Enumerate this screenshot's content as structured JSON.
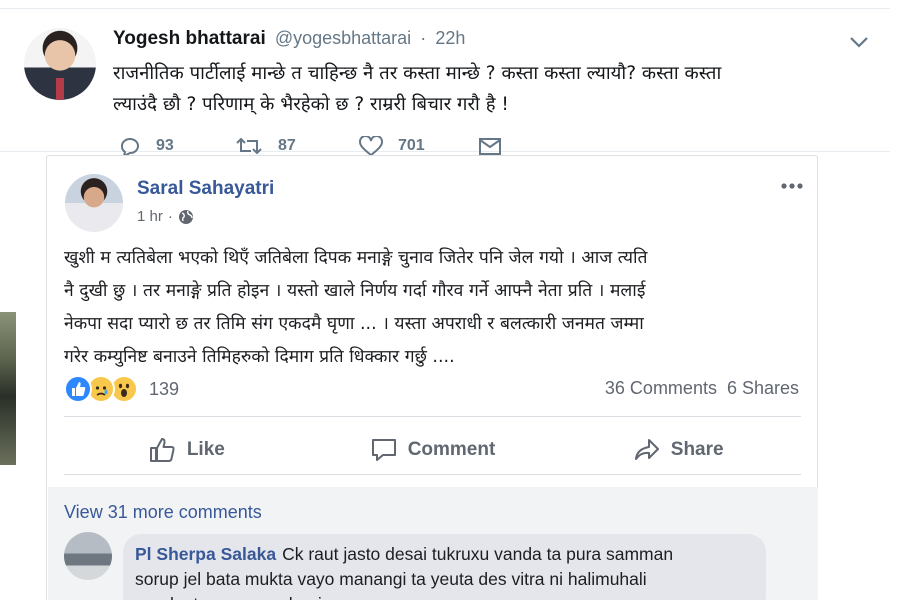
{
  "tweet": {
    "author_name": "Yogesh bhattarai",
    "handle": "@yogesbhattarai",
    "separator": "·",
    "time": "22h",
    "text_line1": "राजनीतिक पार्टीलाई मान्छे त चाहिन्छ नै तर कस्ता मान्छे ? कस्ता कस्ता ल्यायौ? कस्ता कस्ता",
    "text_line2": "ल्याउंदै छौ ? परिणाम्  के भैरहेको छ ? राम्ररी बिचार गरौ है !",
    "reply_count": "93",
    "retweet_count": "87",
    "like_count": "701",
    "icons": [
      "reply-icon",
      "retweet-icon",
      "like-icon",
      "direct-message-icon",
      "chevron-down-icon"
    ]
  },
  "post": {
    "author_name": "Saral Sahayatri",
    "time": "1 hr",
    "separator": "·",
    "audience_icon": "globe-icon",
    "body_line1": "खुशी म त्यतिबेला भएको थिएँ जतिबेला दिपक मनाङ्गे चुनाव जितेर पनि जेल गयो । आज त्यति",
    "body_line2": "नै दुखी छु । तर मनाङ्गे प्रति होइन । यस्तो खाले निर्णय गर्दा गौरव गर्ने आफ्नै नेता प्रति । मलाई",
    "body_line3": "नेकपा सदा प्यारो छ तर तिमि संग एकदमै घृणा ... । यस्ता अपराधी र बलत्कारी जनमत जम्मा",
    "body_line4": "गरेर कम्युनिष्ट बनाउने तिमिहरुको दिमाग प्रति धिक्कार गर्छु ....",
    "reaction_count": "139",
    "reactions": [
      "like",
      "sad",
      "wow"
    ],
    "comments_count": "36 Comments",
    "shares_count": "6 Shares",
    "actions": {
      "like": "Like",
      "comment": "Comment",
      "share": "Share"
    },
    "view_more_comments": "View 31 more comments",
    "comment": {
      "author": "Pl Sherpa Salaka",
      "line1": "Ck raut jasto desai tukruxu vanda ta pura samman",
      "line2": "sorup jel bata mukta vayo manangi ta yeuta des vitra ni halimuhali",
      "line3": "gareko ta samanya hani"
    },
    "colors": {
      "link_blue": "#385898",
      "like_blue": "#2d88ff",
      "reaction_yellow": "#f7c84b",
      "text_gray": "#616770"
    }
  }
}
